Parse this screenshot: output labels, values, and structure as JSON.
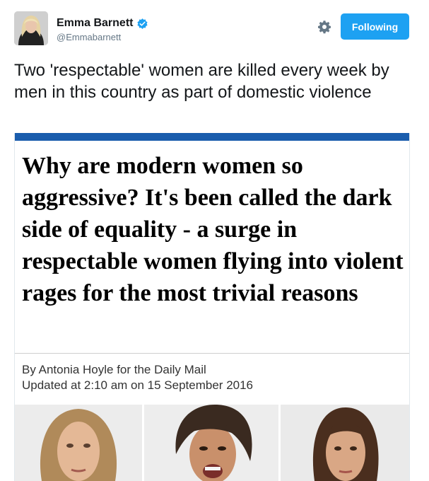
{
  "author": {
    "display_name": "Emma Barnett",
    "handle": "@Emmabarnett",
    "verified": true
  },
  "actions": {
    "follow_label": "Following",
    "gear_icon": "gear-icon"
  },
  "tweet": {
    "text": "Two 'respectable' women are killed every week by men in this country as part of domestic violence"
  },
  "card": {
    "accent_color": "#1a5dad",
    "headline": "Why are modern women so aggressive? It's been called the dark side of equality - a surge in respectable women flying into violent rages for the most trivial reasons",
    "byline": "By Antonia Hoyle for the Daily Mail",
    "updated": "Updated at 2:10 am on 15 September 2016"
  },
  "colors": {
    "follow_button": "#1da1f2",
    "verified_badge": "#1da1f2"
  }
}
